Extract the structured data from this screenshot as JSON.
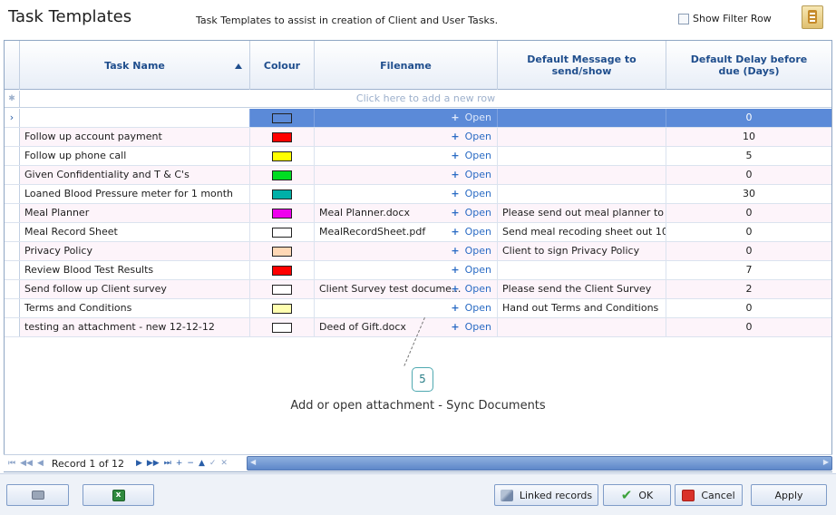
{
  "header": {
    "title": "Task Templates",
    "subtitle": "Task Templates to assist in creation of Client and User Tasks.",
    "filter_label": "Show Filter Row"
  },
  "grid": {
    "columns": [
      "Task Name",
      "Colour",
      "Filename",
      "Default Message to send/show",
      "Default Delay before due (Days)"
    ],
    "new_row_text": "Click here to add a new row",
    "open_label": "Open",
    "rows": [
      {
        "name": "",
        "colour": "#5b8ad8",
        "filename": "",
        "message": "",
        "delay": "0"
      },
      {
        "name": "Follow up account payment",
        "colour": "#ff0000",
        "filename": "",
        "message": "",
        "delay": "10"
      },
      {
        "name": "Follow up phone call",
        "colour": "#ffff00",
        "filename": "",
        "message": "",
        "delay": "5"
      },
      {
        "name": "Given Confidentiality and T & C's",
        "colour": "#00dd22",
        "filename": "",
        "message": "",
        "delay": "0"
      },
      {
        "name": "Loaned Blood Pressure meter for 1 month",
        "colour": "#00b0a8",
        "filename": "",
        "message": "",
        "delay": "30"
      },
      {
        "name": "Meal Planner",
        "colour": "#ee00ee",
        "filename": "Meal Planner.docx",
        "message": "Please send out meal planner to",
        "delay": "0"
      },
      {
        "name": "Meal Record Sheet",
        "colour": "#ffffff",
        "filename": "MealRecordSheet.pdf",
        "message": "Send meal recoding sheet out 10",
        "delay": "0"
      },
      {
        "name": "Privacy Policy",
        "colour": "#ffd7b5",
        "filename": "",
        "message": "Client to sign Privacy Policy",
        "delay": "0"
      },
      {
        "name": "Review Blood Test Results",
        "colour": "#ff0000",
        "filename": "",
        "message": "",
        "delay": "7"
      },
      {
        "name": "Send follow up Client survey",
        "colour": "#ffffff",
        "filename": "Client Survey test docume...",
        "message": "Please send the Client Survey",
        "delay": "2"
      },
      {
        "name": "Terms and Conditions",
        "colour": "#ffffb0",
        "filename": "",
        "message": "Hand out Terms and Conditions",
        "delay": "0"
      },
      {
        "name": "testing an attachment - new 12-12-12",
        "colour": "#ffffff",
        "filename": "Deed of Gift.docx",
        "message": "",
        "delay": "0"
      }
    ]
  },
  "annotation": {
    "number": "5",
    "text": "Add or open attachment - Sync Documents"
  },
  "navigator": {
    "record_text": "Record 1 of 12"
  },
  "footer": {
    "linked_records": "Linked records",
    "ok": "OK",
    "cancel": "Cancel",
    "apply": "Apply"
  }
}
